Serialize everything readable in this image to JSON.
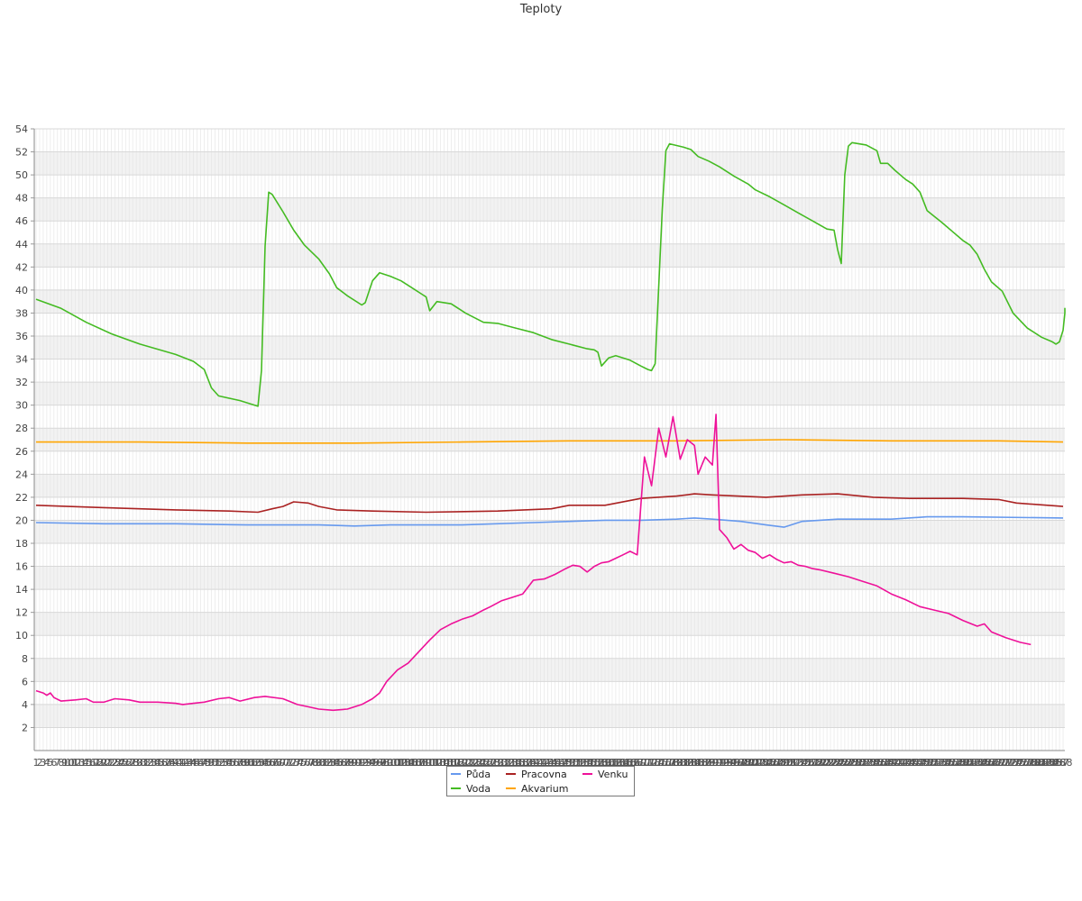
{
  "chart_data": {
    "type": "line",
    "title": "Teploty",
    "xlabel": "",
    "ylabel": "",
    "ylim": [
      0,
      54
    ],
    "yticks": [
      2,
      4,
      6,
      8,
      10,
      12,
      14,
      16,
      18,
      20,
      22,
      24,
      26,
      28,
      30,
      32,
      34,
      36,
      38,
      40,
      42,
      44,
      46,
      48,
      50,
      52,
      54
    ],
    "x_count": 288,
    "grid": true,
    "legend_position": "bottom-center",
    "series": [
      {
        "name": "Půda",
        "color": "#6699ee",
        "points": [
          [
            1,
            19.8
          ],
          [
            20,
            19.7
          ],
          [
            40,
            19.7
          ],
          [
            60,
            19.6
          ],
          [
            80,
            19.6
          ],
          [
            90,
            19.5
          ],
          [
            100,
            19.6
          ],
          [
            120,
            19.6
          ],
          [
            140,
            19.8
          ],
          [
            160,
            20.0
          ],
          [
            170,
            20.0
          ],
          [
            180,
            20.1
          ],
          [
            185,
            20.2
          ],
          [
            190,
            20.1
          ],
          [
            198,
            19.9
          ],
          [
            205,
            19.6
          ],
          [
            210,
            19.4
          ],
          [
            215,
            19.9
          ],
          [
            225,
            20.1
          ],
          [
            240,
            20.1
          ],
          [
            250,
            20.3
          ],
          [
            260,
            20.3
          ],
          [
            288,
            20.2
          ]
        ]
      },
      {
        "name": "Voda",
        "color": "#44bb22",
        "points": [
          [
            1,
            39.2
          ],
          [
            8,
            38.4
          ],
          [
            15,
            37.2
          ],
          [
            22,
            36.2
          ],
          [
            30,
            35.3
          ],
          [
            40,
            34.4
          ],
          [
            45,
            33.8
          ],
          [
            48,
            33.1
          ],
          [
            50,
            31.5
          ],
          [
            52,
            30.8
          ],
          [
            58,
            30.4
          ],
          [
            63,
            29.9
          ],
          [
            64,
            33.0
          ],
          [
            65,
            43.8
          ],
          [
            66,
            48.5
          ],
          [
            67,
            48.3
          ],
          [
            70,
            46.8
          ],
          [
            73,
            45.2
          ],
          [
            76,
            43.9
          ],
          [
            80,
            42.7
          ],
          [
            83,
            41.4
          ],
          [
            85,
            40.2
          ],
          [
            88,
            39.5
          ],
          [
            92,
            38.7
          ],
          [
            93,
            38.9
          ],
          [
            95,
            40.8
          ],
          [
            97,
            41.5
          ],
          [
            100,
            41.2
          ],
          [
            103,
            40.8
          ],
          [
            106,
            40.2
          ],
          [
            109,
            39.6
          ],
          [
            110,
            39.4
          ],
          [
            111,
            38.2
          ],
          [
            113,
            39.0
          ],
          [
            117,
            38.8
          ],
          [
            121,
            38.0
          ],
          [
            126,
            37.2
          ],
          [
            130,
            37.1
          ],
          [
            135,
            36.7
          ],
          [
            140,
            36.3
          ],
          [
            145,
            35.7
          ],
          [
            150,
            35.3
          ],
          [
            155,
            34.9
          ],
          [
            157,
            34.8
          ],
          [
            158,
            34.6
          ],
          [
            159,
            33.4
          ],
          [
            161,
            34.1
          ],
          [
            163,
            34.3
          ],
          [
            167,
            33.9
          ],
          [
            170,
            33.4
          ],
          [
            172,
            33.1
          ],
          [
            173,
            33.0
          ],
          [
            174,
            33.6
          ],
          [
            176,
            47.0
          ],
          [
            177,
            52.1
          ],
          [
            178,
            52.7
          ],
          [
            182,
            52.4
          ],
          [
            184,
            52.2
          ],
          [
            186,
            51.6
          ],
          [
            189,
            51.2
          ],
          [
            192,
            50.7
          ],
          [
            196,
            49.9
          ],
          [
            200,
            49.2
          ],
          [
            202,
            48.7
          ],
          [
            206,
            48.1
          ],
          [
            210,
            47.4
          ],
          [
            214,
            46.7
          ],
          [
            218,
            46.0
          ],
          [
            222,
            45.3
          ],
          [
            224,
            45.2
          ],
          [
            225,
            43.5
          ],
          [
            226,
            42.3
          ],
          [
            227,
            50.0
          ],
          [
            228,
            52.5
          ],
          [
            229,
            52.8
          ],
          [
            233,
            52.6
          ],
          [
            236,
            52.1
          ],
          [
            237,
            51.0
          ],
          [
            239,
            51.0
          ],
          [
            241,
            50.4
          ],
          [
            244,
            49.6
          ],
          [
            246,
            49.2
          ],
          [
            248,
            48.5
          ],
          [
            250,
            46.9
          ],
          [
            252,
            46.4
          ],
          [
            254,
            45.9
          ],
          [
            257,
            45.1
          ],
          [
            260,
            44.3
          ],
          [
            262,
            43.9
          ],
          [
            264,
            43.1
          ],
          [
            266,
            41.8
          ],
          [
            268,
            40.7
          ],
          [
            271,
            39.9
          ],
          [
            274,
            38.0
          ],
          [
            278,
            36.7
          ],
          [
            282,
            35.9
          ],
          [
            285,
            35.5
          ],
          [
            286,
            35.3
          ],
          [
            287,
            35.5
          ],
          [
            288,
            36.5
          ],
          [
            290,
            38.0
          ],
          [
            292,
            38.4
          ],
          [
            295,
            38.3
          ],
          [
            296,
            38.1
          ]
        ]
      },
      {
        "name": "Pracovna",
        "color": "#aa2222",
        "points": [
          [
            1,
            21.3
          ],
          [
            20,
            21.1
          ],
          [
            40,
            20.9
          ],
          [
            55,
            20.8
          ],
          [
            63,
            20.7
          ],
          [
            67,
            21.0
          ],
          [
            70,
            21.2
          ],
          [
            73,
            21.6
          ],
          [
            77,
            21.5
          ],
          [
            80,
            21.2
          ],
          [
            85,
            20.9
          ],
          [
            95,
            20.8
          ],
          [
            110,
            20.7
          ],
          [
            130,
            20.8
          ],
          [
            145,
            21.0
          ],
          [
            150,
            21.3
          ],
          [
            160,
            21.3
          ],
          [
            170,
            21.9
          ],
          [
            180,
            22.1
          ],
          [
            185,
            22.3
          ],
          [
            190,
            22.2
          ],
          [
            205,
            22.0
          ],
          [
            215,
            22.2
          ],
          [
            225,
            22.3
          ],
          [
            235,
            22.0
          ],
          [
            245,
            21.9
          ],
          [
            260,
            21.9
          ],
          [
            270,
            21.8
          ],
          [
            275,
            21.5
          ],
          [
            288,
            21.2
          ]
        ]
      },
      {
        "name": "Akvarium",
        "color": "#ffa500",
        "points": [
          [
            1,
            26.8
          ],
          [
            30,
            26.8
          ],
          [
            60,
            26.7
          ],
          [
            90,
            26.7
          ],
          [
            120,
            26.8
          ],
          [
            150,
            26.9
          ],
          [
            180,
            26.9
          ],
          [
            210,
            27.0
          ],
          [
            240,
            26.9
          ],
          [
            270,
            26.9
          ],
          [
            288,
            26.8
          ]
        ]
      },
      {
        "name": "Venku",
        "color": "#ee1199",
        "points": [
          [
            1,
            5.2
          ],
          [
            3,
            5.0
          ],
          [
            4,
            4.8
          ],
          [
            5,
            5.0
          ],
          [
            6,
            4.6
          ],
          [
            8,
            4.3
          ],
          [
            12,
            4.4
          ],
          [
            15,
            4.5
          ],
          [
            17,
            4.2
          ],
          [
            20,
            4.2
          ],
          [
            23,
            4.5
          ],
          [
            27,
            4.4
          ],
          [
            30,
            4.2
          ],
          [
            35,
            4.2
          ],
          [
            40,
            4.1
          ],
          [
            42,
            4.0
          ],
          [
            45,
            4.1
          ],
          [
            48,
            4.2
          ],
          [
            52,
            4.5
          ],
          [
            55,
            4.6
          ],
          [
            58,
            4.3
          ],
          [
            62,
            4.6
          ],
          [
            65,
            4.7
          ],
          [
            70,
            4.5
          ],
          [
            74,
            4.0
          ],
          [
            77,
            3.8
          ],
          [
            80,
            3.6
          ],
          [
            84,
            3.5
          ],
          [
            88,
            3.6
          ],
          [
            92,
            4.0
          ],
          [
            95,
            4.5
          ],
          [
            97,
            5.0
          ],
          [
            99,
            6.0
          ],
          [
            102,
            7.0
          ],
          [
            105,
            7.6
          ],
          [
            108,
            8.6
          ],
          [
            111,
            9.6
          ],
          [
            114,
            10.5
          ],
          [
            117,
            11.0
          ],
          [
            120,
            11.4
          ],
          [
            123,
            11.7
          ],
          [
            126,
            12.2
          ],
          [
            128,
            12.5
          ],
          [
            131,
            13.0
          ],
          [
            134,
            13.3
          ],
          [
            137,
            13.6
          ],
          [
            140,
            14.8
          ],
          [
            143,
            14.9
          ],
          [
            146,
            15.3
          ],
          [
            149,
            15.8
          ],
          [
            151,
            16.1
          ],
          [
            153,
            16.0
          ],
          [
            155,
            15.5
          ],
          [
            157,
            16.0
          ],
          [
            159,
            16.3
          ],
          [
            161,
            16.4
          ],
          [
            163,
            16.7
          ],
          [
            165,
            17.0
          ],
          [
            167,
            17.3
          ],
          [
            169,
            17.0
          ],
          [
            171,
            25.5
          ],
          [
            173,
            23.0
          ],
          [
            175,
            28.0
          ],
          [
            177,
            25.5
          ],
          [
            179,
            29.0
          ],
          [
            181,
            25.3
          ],
          [
            183,
            27.0
          ],
          [
            185,
            26.5
          ],
          [
            186,
            24.0
          ],
          [
            188,
            25.5
          ],
          [
            190,
            24.8
          ],
          [
            191,
            29.2
          ],
          [
            192,
            19.2
          ],
          [
            194,
            18.5
          ],
          [
            196,
            17.5
          ],
          [
            198,
            17.9
          ],
          [
            200,
            17.4
          ],
          [
            202,
            17.2
          ],
          [
            204,
            16.7
          ],
          [
            206,
            17.0
          ],
          [
            208,
            16.6
          ],
          [
            210,
            16.3
          ],
          [
            212,
            16.4
          ],
          [
            214,
            16.1
          ],
          [
            216,
            16.0
          ],
          [
            218,
            15.8
          ],
          [
            220,
            15.7
          ],
          [
            224,
            15.4
          ],
          [
            228,
            15.1
          ],
          [
            232,
            14.7
          ],
          [
            236,
            14.3
          ],
          [
            240,
            13.6
          ],
          [
            244,
            13.1
          ],
          [
            248,
            12.5
          ],
          [
            252,
            12.2
          ],
          [
            256,
            11.9
          ],
          [
            260,
            11.3
          ],
          [
            264,
            10.8
          ],
          [
            266,
            11.0
          ],
          [
            268,
            10.3
          ],
          [
            272,
            9.8
          ],
          [
            276,
            9.4
          ],
          [
            279,
            9.2
          ]
        ]
      }
    ]
  }
}
